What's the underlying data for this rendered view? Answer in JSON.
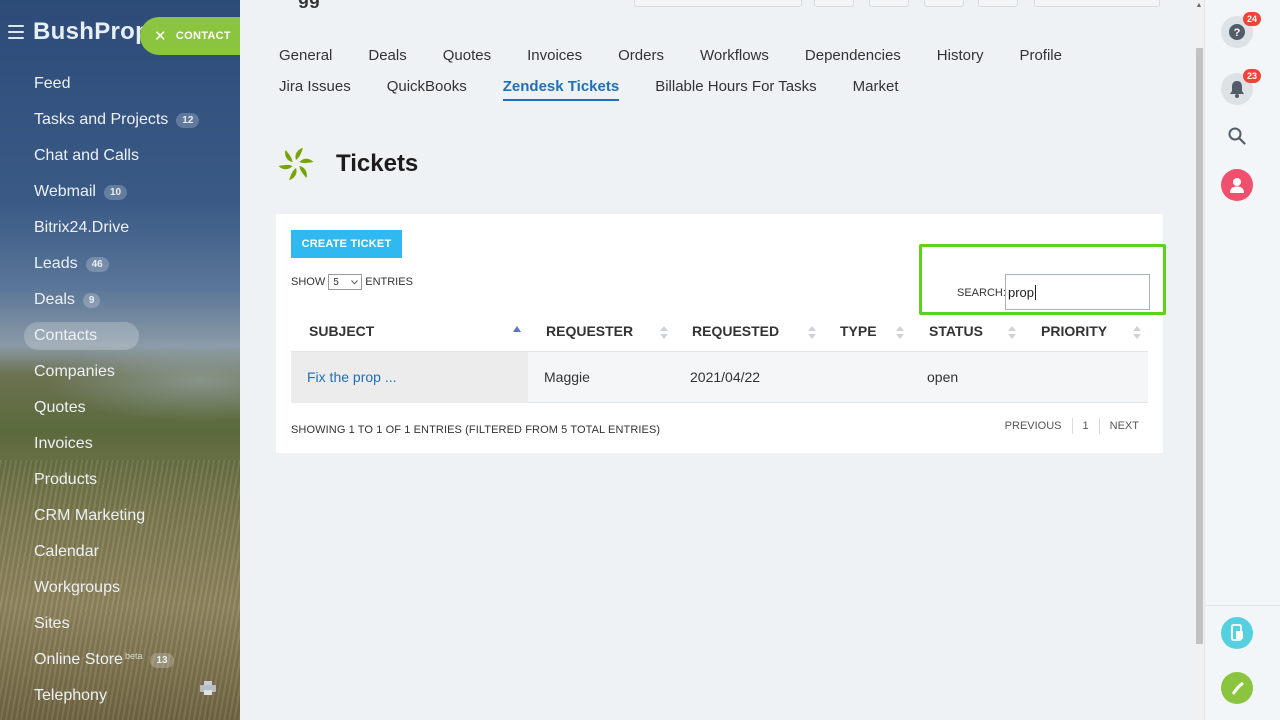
{
  "sidebar": {
    "brand": "BushProp",
    "contact_button": "CONTACT",
    "items": [
      {
        "label": "Feed",
        "count": ""
      },
      {
        "label": "Tasks and Projects",
        "count": "12"
      },
      {
        "label": "Chat and Calls",
        "count": ""
      },
      {
        "label": "Webmail",
        "count": "10"
      },
      {
        "label": "Bitrix24.Drive",
        "count": ""
      },
      {
        "label": "Leads",
        "count": "46"
      },
      {
        "label": "Deals",
        "count": "9"
      },
      {
        "label": "Contacts",
        "count": ""
      },
      {
        "label": "Companies",
        "count": ""
      },
      {
        "label": "Quotes",
        "count": ""
      },
      {
        "label": "Invoices",
        "count": ""
      },
      {
        "label": "Products",
        "count": ""
      },
      {
        "label": "CRM Marketing",
        "count": ""
      },
      {
        "label": "Calendar",
        "count": ""
      },
      {
        "label": "Workgroups",
        "count": ""
      },
      {
        "label": "Sites",
        "count": ""
      },
      {
        "label": "Online Store",
        "count": "13",
        "beta": "beta"
      },
      {
        "label": "Telephony",
        "count": ""
      }
    ],
    "active_item": "Contacts"
  },
  "tabs": {
    "row1": [
      "General",
      "Deals",
      "Quotes",
      "Invoices",
      "Orders",
      "Workflows",
      "Dependencies",
      "History",
      "Profile"
    ],
    "row2": [
      "Jira Issues",
      "QuickBooks",
      "Zendesk Tickets",
      "Billable Hours For Tasks",
      "Market"
    ],
    "active": "Zendesk Tickets"
  },
  "page": {
    "title": "Tickets"
  },
  "tickets": {
    "create_button": "CREATE TICKET",
    "show_label": "SHOW",
    "entries_label": "ENTRIES",
    "page_size": "5",
    "search_label": "SEARCH:",
    "search_value": "prop",
    "columns": [
      "SUBJECT",
      "REQUESTER",
      "REQUESTED",
      "TYPE",
      "STATUS",
      "PRIORITY"
    ],
    "sorted_column": "SUBJECT",
    "rows": [
      {
        "subject": "Fix the prop ...",
        "requester": "Maggie",
        "requested": "2021/04/22",
        "type": "",
        "status": "open",
        "priority": ""
      }
    ],
    "info": "SHOWING 1 TO 1 OF 1 ENTRIES (FILTERED FROM 5 TOTAL ENTRIES)",
    "pager": {
      "previous": "PREVIOUS",
      "page": "1",
      "next": "NEXT"
    }
  },
  "rail": {
    "help_badge": "24",
    "notifications_badge": "23"
  },
  "colors": {
    "accent_blue": "#1f70b8",
    "create_button": "#30b9f0",
    "contact_green": "#8bc43f",
    "highlight_green": "#5bd31c",
    "zendesk_green": "#78a300"
  }
}
